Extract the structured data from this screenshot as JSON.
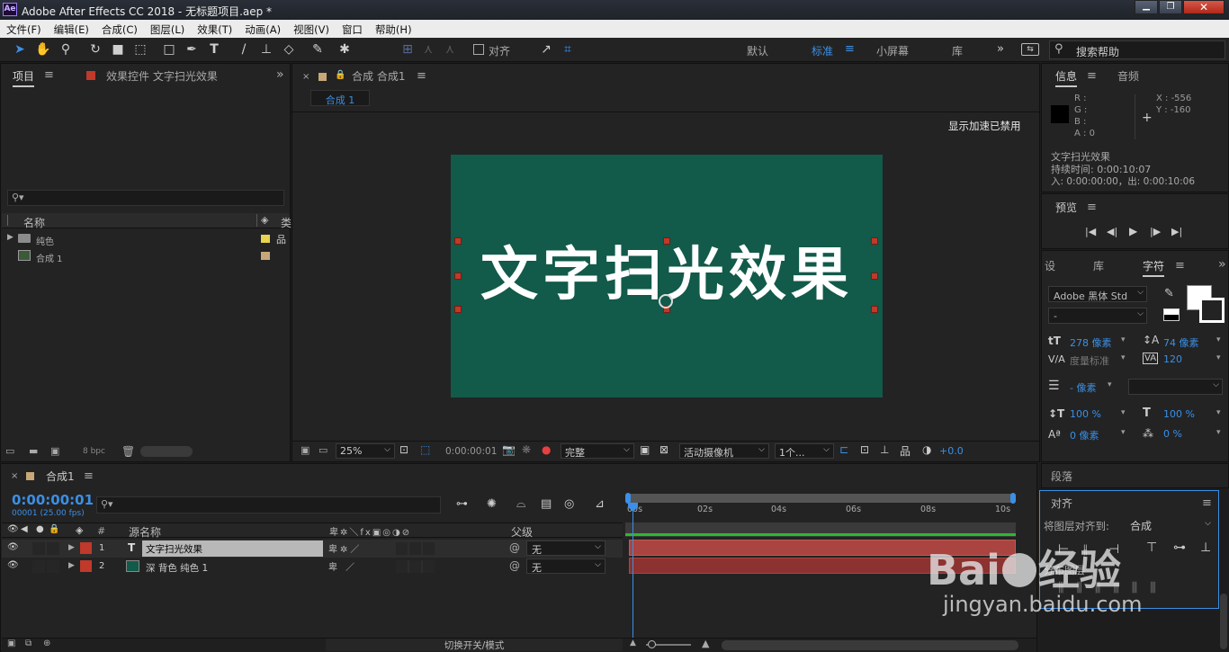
{
  "window": {
    "app_icon": "Ae",
    "title": "Adobe After Effects CC 2018 - 无标题项目.aep *"
  },
  "menu": [
    "文件(F)",
    "编辑(E)",
    "合成(C)",
    "图层(L)",
    "效果(T)",
    "动画(A)",
    "视图(V)",
    "窗口",
    "帮助(H)"
  ],
  "toolbar": {
    "align_label": "对齐",
    "workspaces": [
      "默认",
      "标准",
      "小屏幕",
      "库"
    ],
    "active_workspace": "标准",
    "search_placeholder": "搜索帮助"
  },
  "project_panel": {
    "tab_project": "项目",
    "tab_effect_controls": "效果控件 文字扫光效果",
    "col_name": "名称",
    "col_type": "类",
    "items": [
      {
        "name": "纯色",
        "kind": "folder",
        "color": "#e8d44d"
      },
      {
        "name": "合成 1",
        "kind": "comp",
        "color": "#c8a878"
      }
    ],
    "bpc": "8 bpc"
  },
  "comp_viewer": {
    "tab_label": "合成 合成1",
    "breadcrumb": "合成 1",
    "accel_notice": "显示加速已禁用",
    "canvas_text": "文字扫光效果",
    "canvas_bg": "#125a4a",
    "zoom": "25%",
    "timecode": "0:00:00:01",
    "resolution": "完整",
    "camera": "活动摄像机",
    "views": "1个...",
    "exposure": "+0.0"
  },
  "info_panel": {
    "tab_info": "信息",
    "tab_audio": "音频",
    "r": "R :",
    "g": "G :",
    "b": "B :",
    "a": "A : 0",
    "x": "X : -556",
    "y": "Y : -160",
    "layer_name": "文字扫光效果",
    "duration": "持续时间: 0:00:10:07",
    "inout": "入: 0:00:00:00，出: 0:00:10:06"
  },
  "preview_panel": {
    "title": "预览"
  },
  "character_panel": {
    "tab_settings": "设",
    "tab_library": "库",
    "tab_character": "字符",
    "font": "Adobe 黑体 Std",
    "style": "-",
    "font_size": "278 像素",
    "leading": "74 像素",
    "kerning": "度量标准",
    "tracking": "120",
    "stroke_width": "- 像素",
    "vscale": "100 %",
    "hscale": "100 %",
    "baseline": "0 像素",
    "tsume": "0 %"
  },
  "paragraph_panel": {
    "title": "段落"
  },
  "align_panel": {
    "title": "对齐",
    "align_to_label": "将图层对齐到:",
    "align_to_value": "合成",
    "distribute_label": "分布图层"
  },
  "timeline": {
    "tab_label": "合成1",
    "timecode": "0:00:00:01",
    "frame_info": "00001 (25.00 fps)",
    "col_num": "#",
    "col_source": "源名称",
    "col_parent": "父级",
    "ruler": [
      "00s",
      "02s",
      "04s",
      "06s",
      "08s",
      "10s"
    ],
    "layers": [
      {
        "num": "1",
        "type": "T",
        "name": "文字扫光效果",
        "parent": "无",
        "color": "#c0392b"
      },
      {
        "num": "2",
        "type": "solid",
        "name": "深 背色 纯色 1",
        "parent": "无",
        "color": "#c0392b"
      }
    ],
    "footer_toggle": "切换开关/模式"
  },
  "watermark": {
    "brand": "Bai",
    "brand2": "经验",
    "url": "jingyan.baidu.com"
  }
}
